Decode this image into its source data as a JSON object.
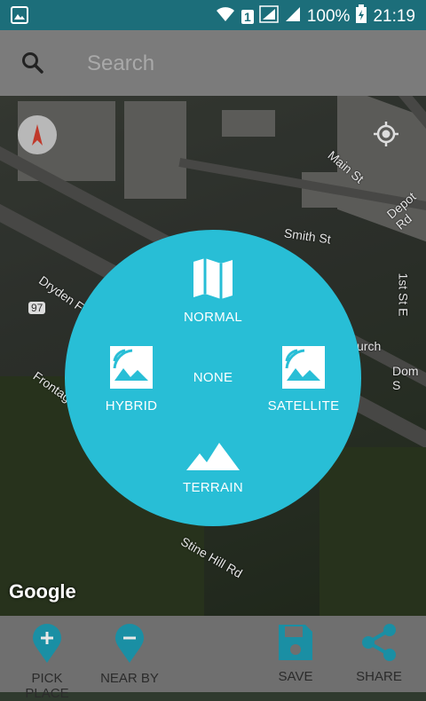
{
  "status_bar": {
    "battery": "100%",
    "time": "21:19",
    "sim": "1"
  },
  "search": {
    "placeholder": "Search"
  },
  "map": {
    "labels": [
      "Main St",
      "Depot Rd",
      "Smith St",
      "Dryden Fr",
      "97",
      "1st St E",
      "urch",
      "Dom S",
      "Frontage",
      "Stine Hill Rd"
    ],
    "watermark": "Google"
  },
  "map_type_menu": {
    "normal": "NORMAL",
    "hybrid": "HYBRID",
    "none": "NONE",
    "satellite": "SATELLITE",
    "terrain": "TERRAIN",
    "accent": "#28bed6"
  },
  "bottom_nav": {
    "pick_place": "PICK PLACE",
    "near_by": "NEAR BY",
    "save": "SAVE",
    "share": "SHARE",
    "icon_color": "#1a8fa4"
  }
}
